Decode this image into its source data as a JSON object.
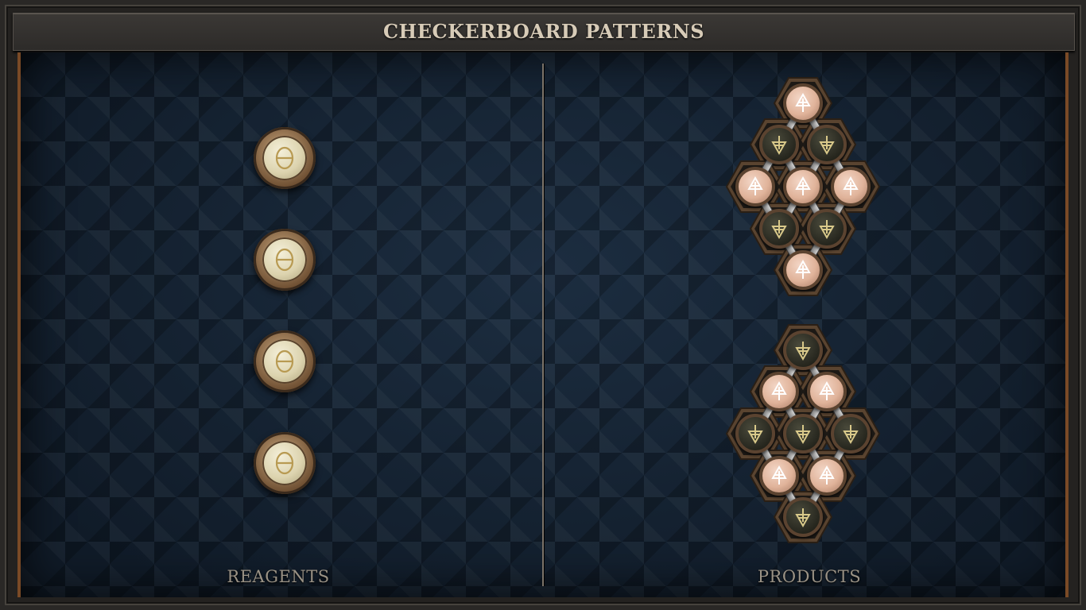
{
  "title": "CHECKERBOARD PATTERNS",
  "reagents_label": "REAGENTS",
  "products_label": "PRODUCTS",
  "colors": {
    "light_atom": "#e0b39a",
    "dark_atom": "#2b2b22",
    "reagent_atom": "#dcd3ae",
    "glyph_light": "#ffffff",
    "glyph_dark": "#d9c98a",
    "glyph_reagent": "#b89a52"
  },
  "reagents": [
    {
      "icon": "theta-icon"
    },
    {
      "icon": "theta-icon"
    },
    {
      "icon": "theta-icon"
    },
    {
      "icon": "theta-icon"
    }
  ],
  "products": [
    {
      "name": "product-1",
      "atoms": [
        "light",
        "dark",
        "dark",
        "light",
        "light",
        "light",
        "dark",
        "dark",
        "light"
      ]
    },
    {
      "name": "product-2",
      "atoms": [
        "dark",
        "light",
        "light",
        "dark",
        "dark",
        "dark",
        "light",
        "light",
        "dark"
      ]
    }
  ]
}
